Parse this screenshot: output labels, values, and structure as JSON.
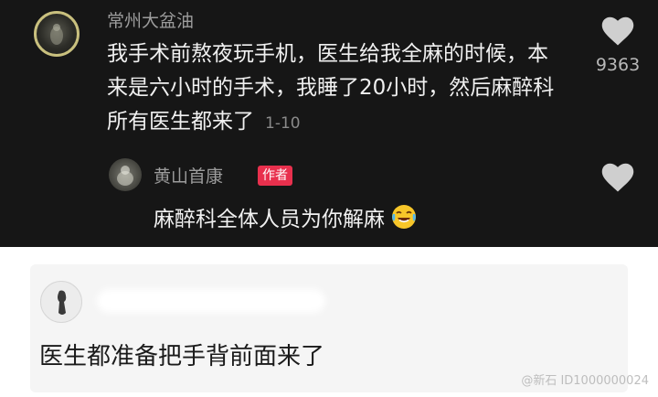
{
  "comment": {
    "username": "常州大盆油",
    "text": "我手术前熬夜玩手机，医生给我全麻的时候，本来是六小时的手术，我睡了20小时，然后麻醉科所有医生都来了",
    "date": "1-10",
    "like_count": "9363"
  },
  "reply": {
    "username": "黄山首康",
    "badge": "作者",
    "text": "麻醉科全体人员为你解麻",
    "emoji": "laughing-crying-emoji"
  },
  "quote_card": {
    "text": "医生都准备把手背前面来了"
  },
  "watermark": {
    "text": "@新石 ID1000000024"
  },
  "colors": {
    "dark_background": "#161616",
    "author_badge": "#e8304d",
    "card_background": "#f5f5f5"
  }
}
